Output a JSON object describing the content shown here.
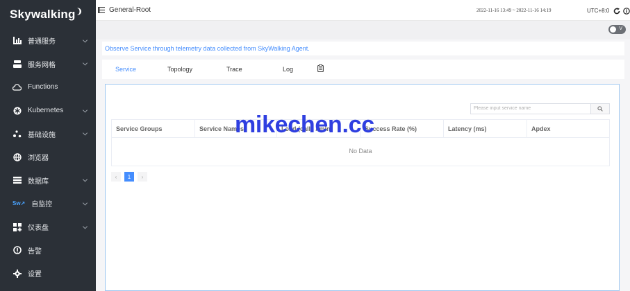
{
  "sidebar": {
    "logo": "Skywalking",
    "items": [
      {
        "label": "普通服务",
        "icon": "chart-bar-icon",
        "expandable": true
      },
      {
        "label": "服务网格",
        "icon": "server-stack-icon",
        "expandable": true
      },
      {
        "label": "Functions",
        "icon": "cloud-icon",
        "expandable": false
      },
      {
        "label": "Kubernetes",
        "icon": "kubernetes-icon",
        "expandable": true
      },
      {
        "label": "基础设施",
        "icon": "infrastructure-icon",
        "expandable": true
      },
      {
        "label": "浏览器",
        "icon": "globe-icon",
        "expandable": false
      },
      {
        "label": "数据库",
        "icon": "database-list-icon",
        "expandable": true
      },
      {
        "label": "自监控",
        "icon": "self-observability-icon",
        "expandable": true
      },
      {
        "label": "仪表盘",
        "icon": "dashboard-icon",
        "expandable": true
      },
      {
        "label": "告警",
        "icon": "alarm-icon",
        "expandable": false
      },
      {
        "label": "设置",
        "icon": "settings-gear-icon",
        "expandable": false
      }
    ]
  },
  "header": {
    "title": "General-Root",
    "date_range": "2022-11-16 13:49 ~ 2022-11-16 14:19",
    "timezone": "UTC+8:0",
    "toggle_label": "V"
  },
  "notice": "Observe Service through telemetry data collected from SkyWalking Agent.",
  "tabs": [
    {
      "label": "Service",
      "active": true
    },
    {
      "label": "Topology",
      "active": false
    },
    {
      "label": "Trace",
      "active": false
    },
    {
      "label": "Log",
      "active": false
    }
  ],
  "search": {
    "placeholder": "Please input service name"
  },
  "table": {
    "columns": [
      "Service Groups",
      "Service Names",
      "Load (calls / min)",
      "Success Rate (%)",
      "Latency (ms)",
      "Apdex"
    ],
    "empty_text": "No Data"
  },
  "pagination": {
    "current": "1",
    "prev": "‹",
    "next": "›"
  },
  "watermark": "mikechen.cc",
  "colors": {
    "accent": "#448dfe",
    "sidebar_bg": "#2b3037",
    "watermark": "#2f3fe0"
  }
}
